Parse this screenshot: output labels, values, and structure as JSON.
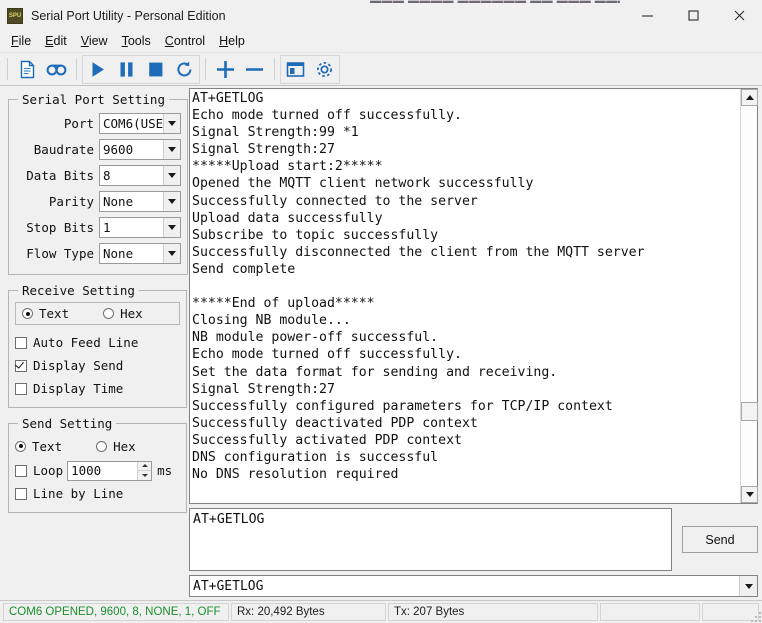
{
  "window": {
    "title": "Serial Port Utility - Personal Edition",
    "app_icon": "spu-app-icon",
    "icon_label": "SPU",
    "minimize_label": "Minimize",
    "maximize_label": "Maximize",
    "close_label": "Close",
    "top_clip_artifact": "▬▬▬  ▬▬▬▬  ▬▬▬▬▬▬ ▬▬  ▬▬▬  ▬▬▬▬ ▬"
  },
  "menubar": {
    "items": [
      {
        "label": "File",
        "accel": "F"
      },
      {
        "label": "Edit",
        "accel": "E"
      },
      {
        "label": "View",
        "accel": "V"
      },
      {
        "label": "Tools",
        "accel": "T"
      },
      {
        "label": "Control",
        "accel": "C"
      },
      {
        "label": "Help",
        "accel": "H"
      }
    ]
  },
  "toolbar": {
    "buttons": [
      {
        "name": "new-document-icon",
        "tooltip": "New"
      },
      {
        "name": "record-log-icon",
        "tooltip": "Log"
      },
      {
        "name": "play-icon",
        "tooltip": "Open Port"
      },
      {
        "name": "pause-icon",
        "tooltip": "Pause"
      },
      {
        "name": "stop-icon",
        "tooltip": "Close Port"
      },
      {
        "name": "refresh-icon",
        "tooltip": "Refresh"
      },
      {
        "name": "plus-icon",
        "tooltip": "Add"
      },
      {
        "name": "minus-icon",
        "tooltip": "Remove"
      },
      {
        "name": "layout-panel-icon",
        "tooltip": "Layout"
      },
      {
        "name": "gear-icon",
        "tooltip": "Settings"
      }
    ]
  },
  "serial_port_setting": {
    "legend": "Serial Port Setting",
    "fields": [
      {
        "label": "Port",
        "value": "COM6(USE",
        "name": "port-combo"
      },
      {
        "label": "Baudrate",
        "value": "9600",
        "name": "baudrate-combo"
      },
      {
        "label": "Data Bits",
        "value": "8",
        "name": "data-bits-combo"
      },
      {
        "label": "Parity",
        "value": "None",
        "name": "parity-combo"
      },
      {
        "label": "Stop Bits",
        "value": "1",
        "name": "stop-bits-combo"
      },
      {
        "label": "Flow Type",
        "value": "None",
        "name": "flow-type-combo"
      }
    ]
  },
  "receive_setting": {
    "legend": "Receive Setting",
    "mode_text": "Text",
    "mode_hex": "Hex",
    "mode_selected": "Text",
    "checkboxes": [
      {
        "label": "Auto Feed Line",
        "checked": false,
        "name": "auto-feed-line-checkbox"
      },
      {
        "label": "Display Send",
        "checked": true,
        "name": "display-send-checkbox"
      },
      {
        "label": "Display Time",
        "checked": false,
        "name": "display-time-checkbox"
      }
    ]
  },
  "send_setting": {
    "legend": "Send Setting",
    "mode_text": "Text",
    "mode_hex": "Hex",
    "mode_selected": "Text",
    "loop_label": "Loop",
    "loop_checked": false,
    "loop_value": "1000",
    "loop_unit": "ms",
    "line_by_line_label": "Line by Line",
    "line_by_line_checked": false
  },
  "terminal": {
    "lines": [
      "AT+GETLOG",
      "Echo mode turned off successfully.",
      "Signal Strength:99 *1",
      "Signal Strength:27",
      "*****Upload start:2*****",
      "Opened the MQTT client network successfully",
      "Successfully connected to the server",
      "Upload data successfully",
      "Subscribe to topic successfully",
      "Successfully disconnected the client from the MQTT server",
      "Send complete",
      "",
      "*****End of upload*****",
      "Closing NB module...",
      "NB module power-off successful.",
      "Echo mode turned off successfully.",
      "Set the data format for sending and receiving.",
      "Signal Strength:27",
      "Successfully configured parameters for TCP/IP context",
      "Successfully deactivated PDP context",
      "Successfully activated PDP context",
      "DNS configuration is successful",
      "No DNS resolution required"
    ],
    "scrollbar": {
      "name": "terminal-vertical-scrollbar",
      "thumb_top_pct": 82
    }
  },
  "send_area": {
    "input_value": "AT+GETLOG",
    "input_placeholder": "",
    "send_button_label": "Send",
    "history_value": "AT+GETLOG"
  },
  "statusbar": {
    "connection": "COM6 OPENED, 9600, 8, NONE, 1, OFF",
    "rx": "Rx: 20,492 Bytes",
    "tx": "Tx: 207 Bytes",
    "panel4": "",
    "panel5": "",
    "connection_color": "#1a8f2c"
  }
}
